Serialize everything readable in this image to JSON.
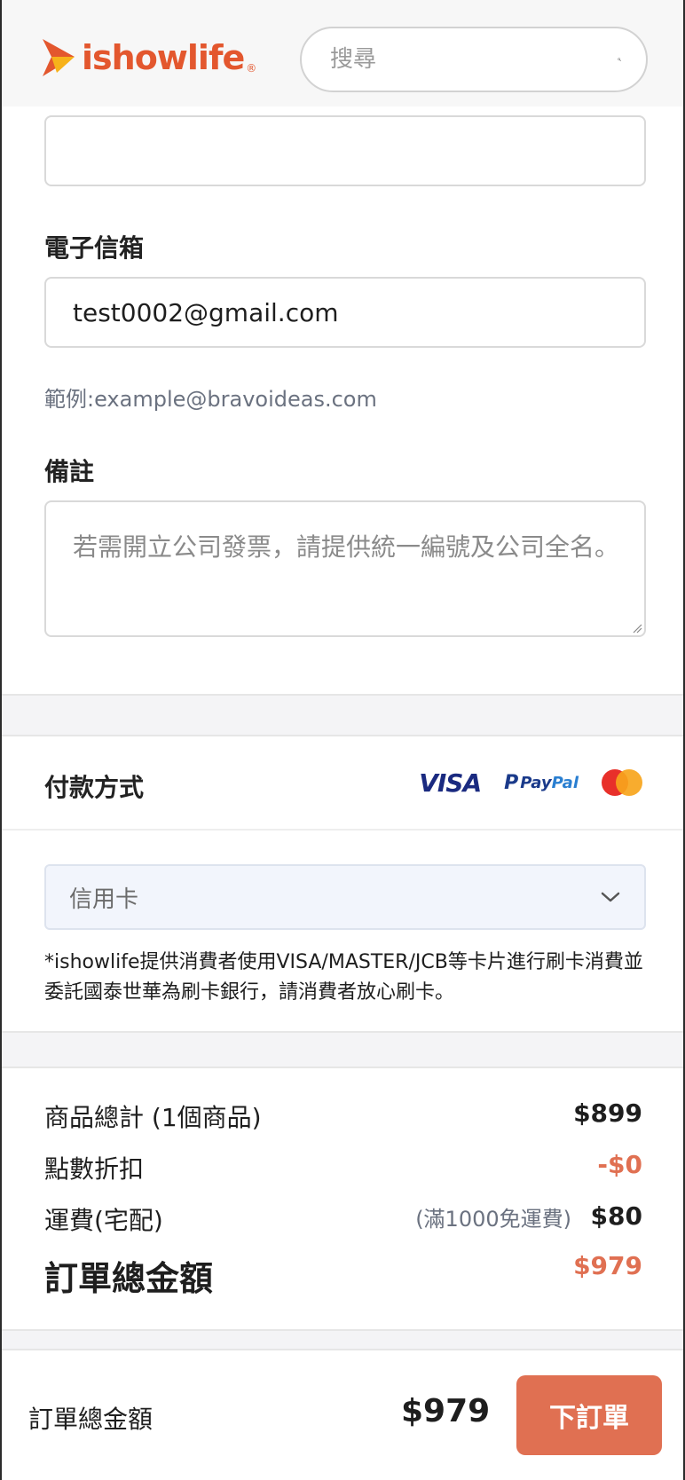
{
  "header": {
    "logo_text": "ishowlife",
    "logo_reg": "®",
    "search_placeholder": "搜尋"
  },
  "form": {
    "email": {
      "label": "電子信箱",
      "value": "test0002@gmail.com",
      "helper": "範例:example@bravoideas.com"
    },
    "notes": {
      "label": "備註",
      "placeholder": "若需開立公司發票，請提供統一編號及公司全名。"
    }
  },
  "payment": {
    "title": "付款方式",
    "logos": {
      "visa": "VISA",
      "paypal_p": "P",
      "paypal_pay": "Pay",
      "paypal_pal": "Pal"
    },
    "method": "信用卡",
    "note": "*ishowlife提供消費者使用VISA/MASTER/JCB等卡片進行刷卡消費並委託國泰世華為刷卡銀行，請消費者放心刷卡。"
  },
  "summary": {
    "subtotal_label": "商品總計 (1個商品)",
    "subtotal_value": "$899",
    "points_label": "點數折扣",
    "points_value": "-$0",
    "shipping_label": "運費(宅配)",
    "shipping_note": "(滿1000免運費)",
    "shipping_value": "$80",
    "total_label": "訂單總金額",
    "total_value": "$979"
  },
  "bottom_bar": {
    "label": "訂單總金額",
    "amount": "$979",
    "order_button": "下訂單"
  },
  "colors": {
    "brand": "#e3572e",
    "accent": "#e07052",
    "select_bg": "#f2f5fc"
  }
}
